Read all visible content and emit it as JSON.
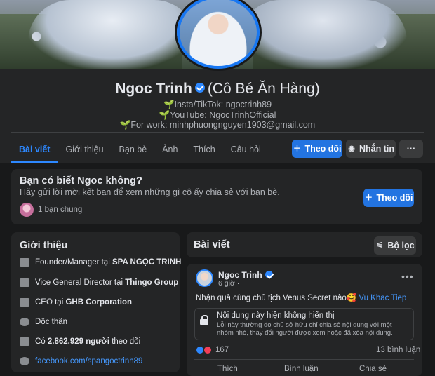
{
  "profile": {
    "name": "Ngoc Trinh",
    "alias": "(Cô Bé Ăn Hàng)",
    "bio": [
      "🌱Insta/TikTok: ngoctrinh89",
      "🌱YouTube: NgocTrinhOfficial",
      "🌱For work: minhphuongnguyen1903@gmail.com"
    ]
  },
  "tabs": [
    "Bài viết",
    "Giới thiệu",
    "Bạn bè",
    "Ảnh",
    "Thích",
    "Câu hỏi"
  ],
  "actions": {
    "follow": "Theo dõi",
    "message": "Nhắn tin",
    "more": "···"
  },
  "know": {
    "title": "Bạn có biết Ngoc không?",
    "subtitle": "Hãy gửi lời mời kết bạn để xem những gì cô ấy chia sẻ với bạn bè.",
    "follow": "Theo dõi",
    "mutual": "1 bạn chung"
  },
  "intro": {
    "title": "Giới thiệu",
    "items": [
      {
        "prefix": "Founder/Manager tại ",
        "bold": "SPA NGỌC TRINH",
        "suffix": "",
        "icon": "briefcase-icon"
      },
      {
        "prefix": "Vice General Director tại ",
        "bold": "Thingo Group",
        "suffix": "",
        "icon": "briefcase-icon"
      },
      {
        "prefix": "CEO tại ",
        "bold": "GHB Corporation",
        "suffix": "",
        "icon": "briefcase-icon"
      },
      {
        "prefix": "Độc thân",
        "bold": "",
        "suffix": "",
        "icon": "heart-icon"
      },
      {
        "prefix": "Có ",
        "bold": "2.862.929 người",
        "suffix": " theo dõi",
        "icon": "rss-icon"
      }
    ],
    "link": "facebook.com/spangoctrinh89"
  },
  "posts": {
    "title": "Bài viết",
    "filter": "Bộ lọc",
    "post": {
      "author": "Ngoc Trinh",
      "time": "6 giờ ·",
      "text": "Nhận quà cùng chủ tịch Venus Secret nào🥰 ",
      "tag": "Vu Khac Tiep",
      "hidden_title": "Nội dung này hiện không hiển thị",
      "hidden_sub": "Lỗi này thường do chủ sở hữu chỉ chia sẻ nội dung với một nhóm nhỏ, thay đổi người được xem hoặc đã xóa nội dung.",
      "reactions": "167",
      "comments": "13 bình luận",
      "actions": [
        "Thích",
        "Bình luận",
        "Chia sẻ"
      ]
    }
  },
  "colors": {
    "accent": "#2d88ff",
    "button_blue": "#2374e1",
    "bg": "#18191a",
    "card": "#242526"
  }
}
